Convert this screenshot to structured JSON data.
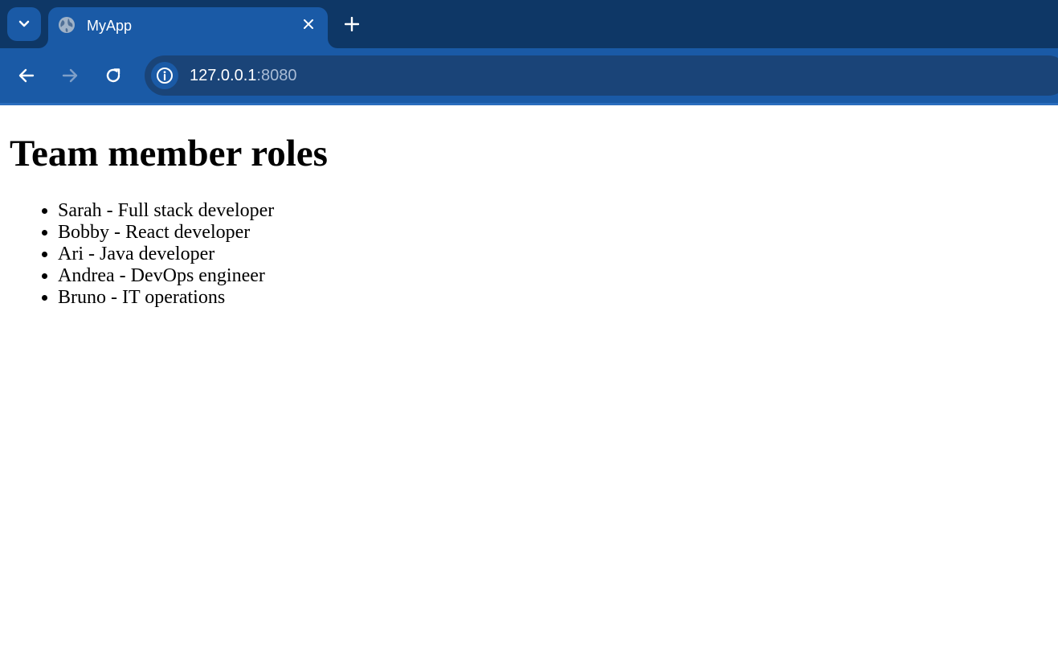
{
  "browser": {
    "tab": {
      "title": "MyApp",
      "favicon": "globe-icon"
    },
    "address_bar": {
      "host": "127.0.0.1",
      "port": ":8080"
    },
    "colors": {
      "tabstrip_bg": "#0e3766",
      "toolbar_bg": "#1a5aa6",
      "omnibox_bg": "#1a4478"
    }
  },
  "page": {
    "title": "Team member roles",
    "roles": [
      "Sarah - Full stack developer",
      "Bobby - React developer",
      "Ari - Java developer",
      "Andrea - DevOps engineer",
      "Bruno - IT operations"
    ]
  }
}
